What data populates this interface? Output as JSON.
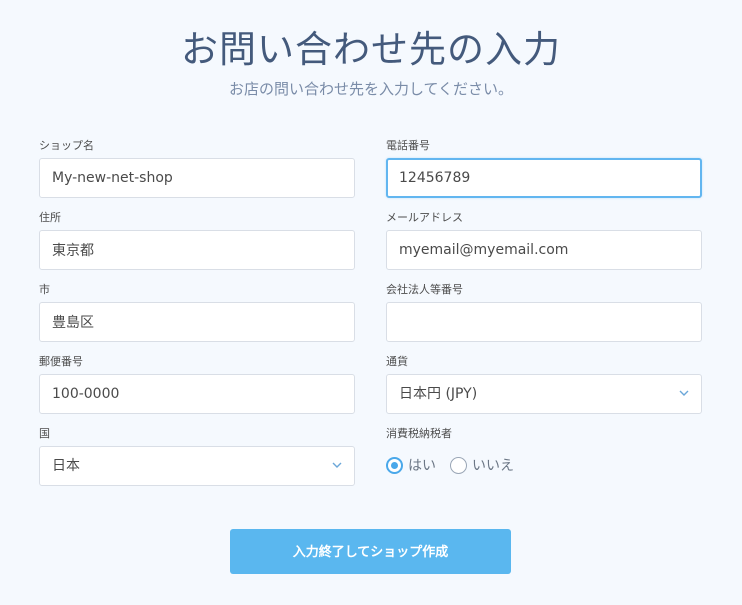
{
  "header": {
    "title": "お問い合わせ先の入力",
    "subtitle": "お店の問い合わせ先を入力してください。"
  },
  "form": {
    "shop_name": {
      "label": "ショップ名",
      "value": "My-new-net-shop"
    },
    "phone": {
      "label": "電話番号",
      "value": "12456789"
    },
    "address": {
      "label": "住所",
      "value": "東京都"
    },
    "email": {
      "label": "メールアドレス",
      "value": "myemail@myemail.com"
    },
    "city": {
      "label": "市",
      "value": "豊島区"
    },
    "corporate_number": {
      "label": "会社法人等番号",
      "value": ""
    },
    "postal_code": {
      "label": "郵便番号",
      "value": "100-0000"
    },
    "currency": {
      "label": "通貨",
      "selected": "日本円 (JPY)"
    },
    "country": {
      "label": "国",
      "selected": "日本"
    },
    "tax_payer": {
      "label": "消費税納税者",
      "options": [
        {
          "label": "はい",
          "checked": true
        },
        {
          "label": "いいえ",
          "checked": false
        }
      ]
    },
    "submit_label": "入力終了してショップ作成"
  },
  "colors": {
    "background": "#f5f9fe",
    "title": "#445a7c",
    "accent": "#5ab7ef",
    "focus_border": "#62b6f0"
  },
  "icons": {
    "select_arrow": "chevron-down-icon",
    "radio": "radio-icon"
  }
}
